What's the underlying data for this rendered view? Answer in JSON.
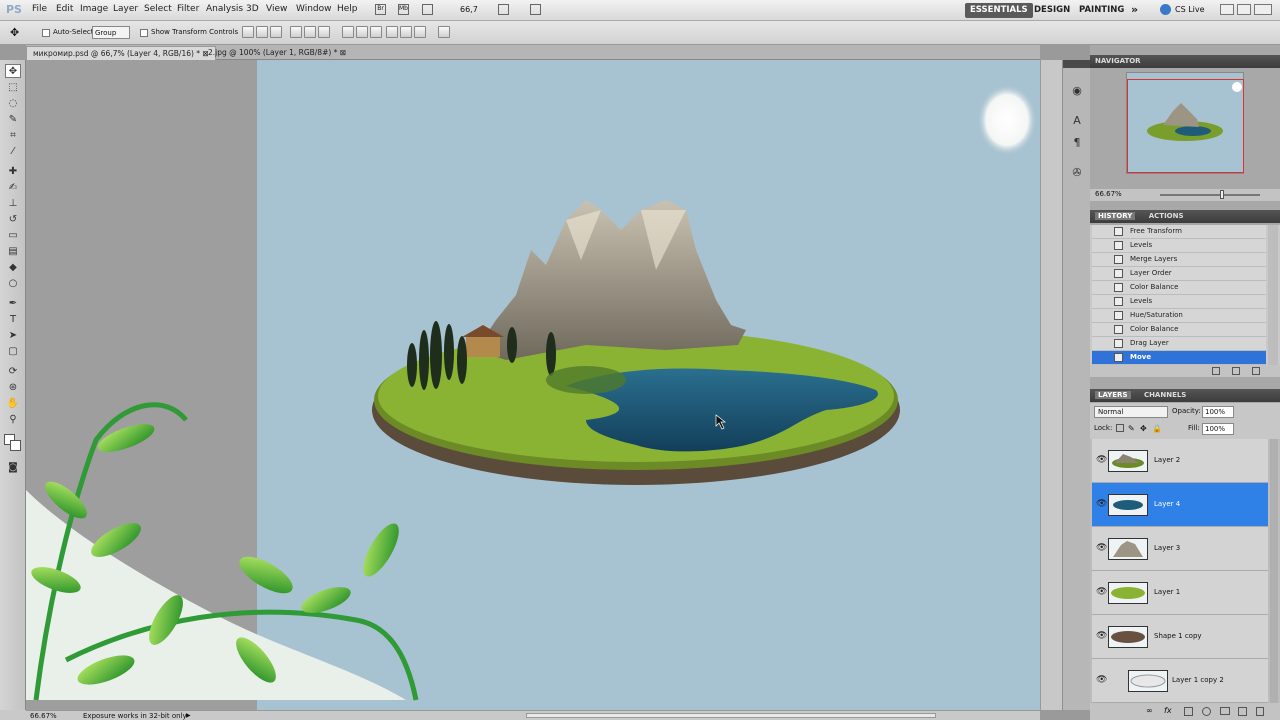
{
  "app": {
    "logo": "PS"
  },
  "menu": [
    "File",
    "Edit",
    "Image",
    "Layer",
    "Select",
    "Filter",
    "Analysis",
    "3D",
    "View",
    "Window",
    "Help"
  ],
  "zoom_box": "66,7",
  "workspaces": {
    "essentials": "ESSENTIALS",
    "design": "DESIGN",
    "painting": "PAINTING",
    "more": "»",
    "cslive": "CS Live"
  },
  "options": {
    "auto_select": "Auto-Select:",
    "auto_select_value": "Group",
    "show_transform": "Show Transform Controls"
  },
  "doc_tabs": [
    {
      "label": "микромир.psd @ 66,7% (Layer 4, RGB/16) *",
      "active": true
    },
    {
      "label": "2.jpg @ 100% (Layer 1, RGB/8#) *",
      "active": false
    }
  ],
  "navigator": {
    "title": "NAVIGATOR",
    "zoom": "66.67%"
  },
  "history": {
    "tabs": [
      "HISTORY",
      "ACTIONS"
    ],
    "items": [
      "Free Transform",
      "Levels",
      "Merge Layers",
      "Layer Order",
      "Color Balance",
      "Levels",
      "Hue/Saturation",
      "Color Balance",
      "Drag Layer",
      "Move"
    ],
    "selected_index": 9
  },
  "layers": {
    "tabs": [
      "LAYERS",
      "CHANNELS"
    ],
    "blend_mode": "Normal",
    "opacity_label": "Opacity:",
    "opacity": "100%",
    "lock_label": "Lock:",
    "fill_label": "Fill:",
    "fill": "100%",
    "items": [
      {
        "name": "Layer 2",
        "selected": false
      },
      {
        "name": "Layer 4",
        "selected": true
      },
      {
        "name": "Layer 3",
        "selected": false
      },
      {
        "name": "Layer 1",
        "selected": false
      },
      {
        "name": "Shape 1 copy",
        "selected": false
      },
      {
        "name": "Layer 1 copy 2",
        "selected": false
      }
    ]
  },
  "status": {
    "zoom": "66.67%",
    "message": "Exposure works in 32-bit only"
  },
  "colors": {
    "doc_bg": "#a7c2d0",
    "selection": "#2f81e8",
    "panel_header": "#444444"
  }
}
